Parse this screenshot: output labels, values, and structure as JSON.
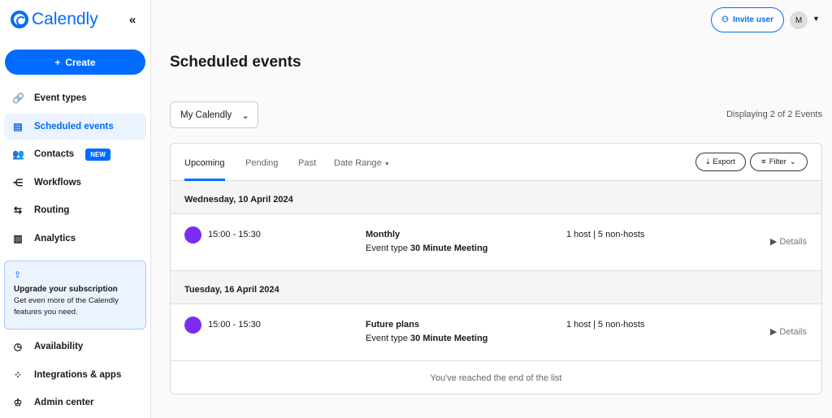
{
  "brand": "Calendly",
  "sidebar": {
    "create": "Create",
    "items": [
      {
        "label": "Event types",
        "icon": "🔗"
      },
      {
        "label": "Scheduled events",
        "icon": "▤"
      },
      {
        "label": "Contacts",
        "icon": "👥",
        "badge": "NEW"
      },
      {
        "label": "Workflows",
        "icon": "⋲"
      },
      {
        "label": "Routing",
        "icon": "⇆"
      },
      {
        "label": "Analytics",
        "icon": "▥"
      }
    ],
    "upgrade": {
      "title": "Upgrade your subscription",
      "text": "Get even more of the Calendly features you need."
    },
    "bottom": [
      {
        "label": "Availability",
        "icon": "◷"
      },
      {
        "label": "Integrations & apps",
        "icon": "⁘"
      },
      {
        "label": "Admin center",
        "icon": "♔"
      }
    ]
  },
  "header": {
    "invite": "Invite user",
    "avatar": "M"
  },
  "page": {
    "title": "Scheduled events",
    "select": "My Calendly",
    "count": "Displaying 2 of 2 Events"
  },
  "tabs": [
    "Upcoming",
    "Pending",
    "Past",
    "Date Range"
  ],
  "actions": {
    "export": "Export",
    "filter": "Filter"
  },
  "days": [
    {
      "date": "Wednesday, 10 April 2024",
      "time": "15:00 - 15:30",
      "title": "Monthly",
      "etype_label": "Event type",
      "etype": "30 Minute Meeting",
      "hosts": "1 host | 5 non-hosts",
      "details": "Details"
    },
    {
      "date": "Tuesday, 16 April 2024",
      "time": "15:00 - 15:30",
      "title": "Future plans",
      "etype_label": "Event type",
      "etype": "30 Minute Meeting",
      "hosts": "1 host | 5 non-hosts",
      "details": "Details"
    }
  ],
  "end_text": "You've reached the end of the list"
}
